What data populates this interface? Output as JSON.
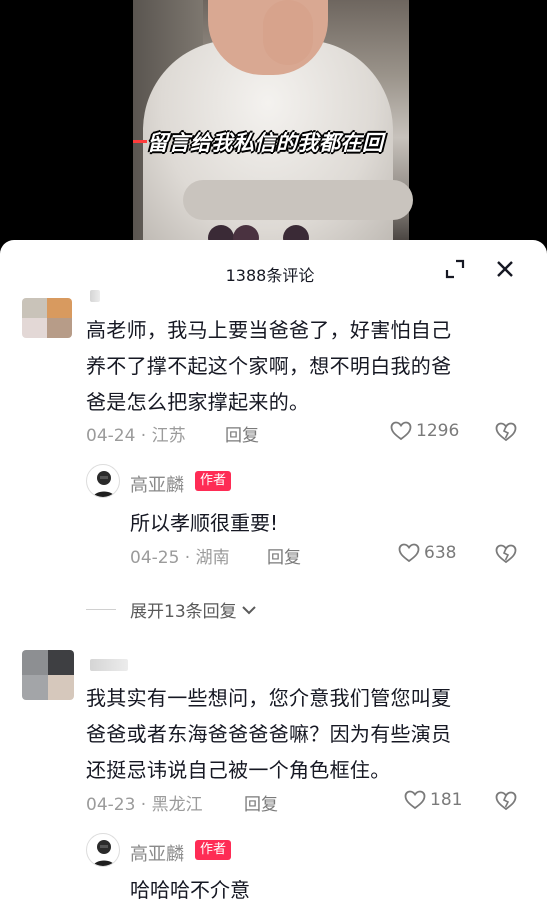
{
  "video": {
    "caption": "留言给我私信的我都在回"
  },
  "sheet": {
    "comment_count": "1388条评论"
  },
  "comments": [
    {
      "text_lines": [
        "高老师，我马上要当爸爸了，好害怕自己",
        "养不了撑不起这个家啊，想不明白我的爸",
        "爸是怎么把家撑起来的。"
      ],
      "date": "04-24",
      "location": "江苏",
      "reply_label": "回复",
      "likes": "1296",
      "author_reply": {
        "name": "高亚麟",
        "badge": "作者",
        "text": "所以孝顺很重要!",
        "date": "04-25",
        "location": "湖南",
        "reply_label": "回复",
        "likes": "638"
      },
      "expand_label": "展开13条回复"
    },
    {
      "text_lines": [
        "我其实有一些想问，您介意我们管您叫夏",
        "爸爸或者东海爸爸爸爸嘛？因为有些演员",
        "还挺忌讳说自己被一个角色框住。"
      ],
      "date": "04-23",
      "location": "黑龙江",
      "reply_label": "回复",
      "likes": "181",
      "author_reply": {
        "name": "高亚麟",
        "badge": "作者",
        "text": "哈哈哈不介意"
      }
    }
  ],
  "icons": {
    "expand": "expand-icon",
    "close": "close-icon",
    "like": "heart-outline-icon",
    "dislike": "broken-heart-icon",
    "chevron": "chevron-down-icon"
  },
  "colors": {
    "badge": "#fe2c55",
    "text": "#161823",
    "meta": "#9b9b9b"
  }
}
